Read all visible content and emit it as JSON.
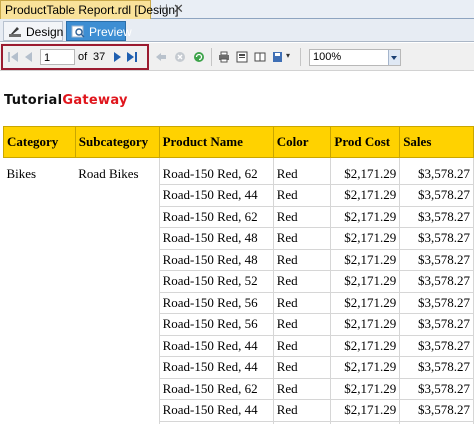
{
  "document_tab": {
    "title": "ProductTable Report.rdl [Design]"
  },
  "view_tabs": [
    {
      "label": "Design"
    },
    {
      "label": "Preview"
    }
  ],
  "toolbar": {
    "current_page": "1",
    "of_label": "of",
    "total_pages": "37",
    "zoom": "100%"
  },
  "logo": {
    "part1": "Tutorial",
    "part2": "Gateway"
  },
  "table": {
    "headers": [
      "Category",
      "Subcategory",
      "Product Name",
      "Color",
      "Prod Cost",
      "Sales"
    ],
    "rows": [
      [
        "Bikes",
        "Road Bikes",
        "Road-150 Red, 62",
        "Red",
        "$2,171.29",
        "$3,578.27"
      ],
      [
        "",
        "",
        "Road-150 Red, 44",
        "Red",
        "$2,171.29",
        "$3,578.27"
      ],
      [
        "",
        "",
        "Road-150 Red, 62",
        "Red",
        "$2,171.29",
        "$3,578.27"
      ],
      [
        "",
        "",
        "Road-150 Red, 48",
        "Red",
        "$2,171.29",
        "$3,578.27"
      ],
      [
        "",
        "",
        "Road-150 Red, 48",
        "Red",
        "$2,171.29",
        "$3,578.27"
      ],
      [
        "",
        "",
        "Road-150 Red, 52",
        "Red",
        "$2,171.29",
        "$3,578.27"
      ],
      [
        "",
        "",
        "Road-150 Red, 56",
        "Red",
        "$2,171.29",
        "$3,578.27"
      ],
      [
        "",
        "",
        "Road-150 Red, 56",
        "Red",
        "$2,171.29",
        "$3,578.27"
      ],
      [
        "",
        "",
        "Road-150 Red, 44",
        "Red",
        "$2,171.29",
        "$3,578.27"
      ],
      [
        "",
        "",
        "Road-150 Red, 44",
        "Red",
        "$2,171.29",
        "$3,578.27"
      ],
      [
        "",
        "",
        "Road-150 Red, 62",
        "Red",
        "$2,171.29",
        "$3,578.27"
      ],
      [
        "",
        "",
        "Road-150 Red, 44",
        "Red",
        "$2,171.29",
        "$3,578.27"
      ],
      [
        "",
        "",
        "Road-150 Red, 62",
        "Red",
        "$2,171.29",
        "$3,578.27"
      ]
    ]
  },
  "colors": {
    "header_bg": "#ffd200",
    "preview_tab": "#3d8ed3",
    "highlight": "#9b1b30",
    "logo_red": "#e0151c"
  },
  "icons": [
    "pin-icon",
    "close-icon",
    "design-icon",
    "preview-icon",
    "first-page-icon",
    "previous-page-icon",
    "next-page-icon",
    "last-page-icon",
    "back-icon",
    "stop-icon",
    "refresh-icon",
    "print-icon",
    "print-layout-icon",
    "page-setup-icon",
    "export-icon",
    "zoom-dropdown-icon"
  ]
}
